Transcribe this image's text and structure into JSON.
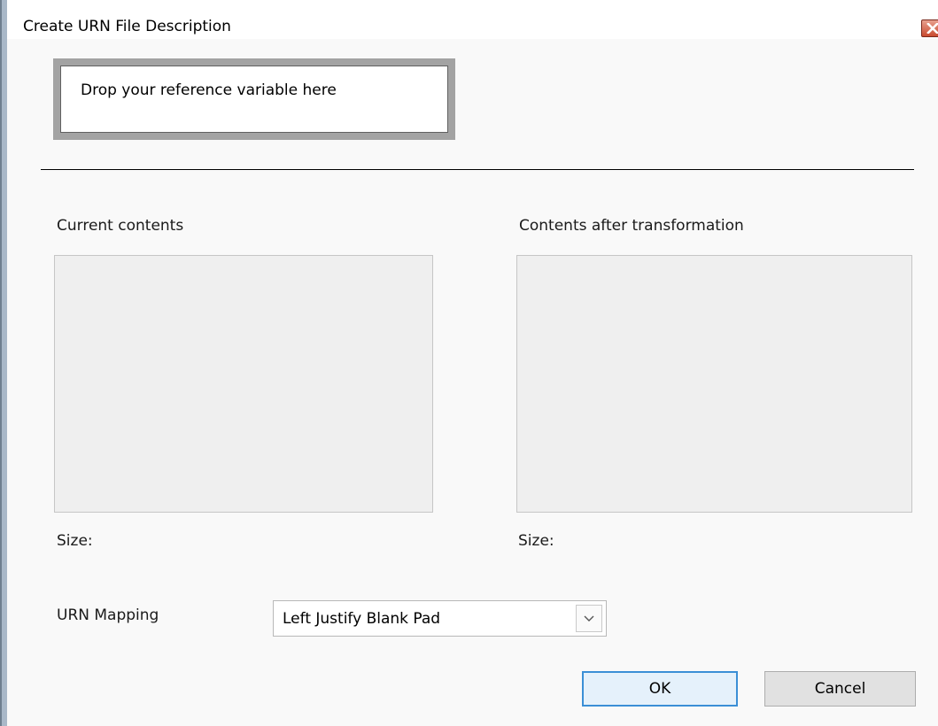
{
  "window": {
    "title": "Create URN File Description"
  },
  "drop_zone": {
    "text": "Drop your reference variable here"
  },
  "current": {
    "label": "Current contents",
    "size_label": "Size:"
  },
  "after": {
    "label": "Contents after transformation",
    "size_label": "Size:"
  },
  "mapping": {
    "label": "URN Mapping",
    "selected": "Left Justify Blank Pad"
  },
  "buttons": {
    "ok": "OK",
    "cancel": "Cancel"
  },
  "colors": {
    "close_button": "#c94a2f",
    "default_button_border": "#3b8fd6"
  },
  "icons": {
    "close": "close-icon",
    "dropdown": "chevron-down-icon"
  }
}
